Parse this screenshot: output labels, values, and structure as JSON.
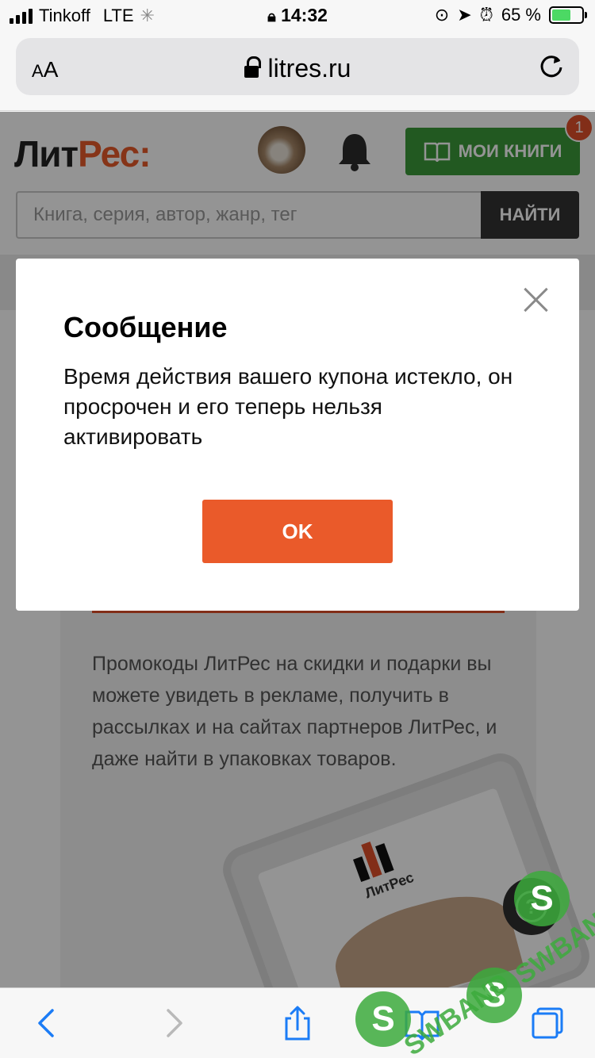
{
  "status_bar": {
    "carrier": "Tinkoff",
    "network": "LTE",
    "time": "14:32",
    "battery_percent": "65 %",
    "battery_level": 0.65
  },
  "browser": {
    "text_size_label": "AA",
    "url": "litres.ru"
  },
  "header": {
    "logo_part1": "Лит",
    "logo_part2": "Рес:",
    "my_books_label": "МОИ КНИГИ",
    "notification_count": "1"
  },
  "search": {
    "placeholder": "Книга, серия, автор, жанр, тег",
    "button_label": "НАЙТИ"
  },
  "promo": {
    "text": "Промокоды ЛитРес на скидки и подарки вы можете увидеть в рекламе, получить в рассылках и на сайтах партнеров ЛитРес, и даже найти в упаковках товаров.",
    "phone_logo": "ЛитРес"
  },
  "help": {
    "label": "?"
  },
  "modal": {
    "title": "Сообщение",
    "message": "Время действия вашего купона истекло, он просрочен и его теперь нельзя активировать",
    "ok_label": "OK"
  },
  "watermark": {
    "text": "SWBAND",
    "letter": "S"
  },
  "colors": {
    "brand_orange": "#ea5a2a",
    "brand_green": "#3c9a3a"
  }
}
